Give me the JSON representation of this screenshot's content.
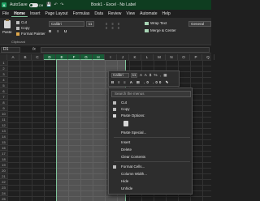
{
  "titlebar": {
    "autosave": "AutoSave",
    "autosave_state": "Off",
    "title": "Book1 - Excel",
    "sensitivity": "No Label"
  },
  "menu_tabs": [
    "File",
    "Home",
    "Insert",
    "Page Layout",
    "Formulas",
    "Data",
    "Review",
    "View",
    "Automate",
    "Help"
  ],
  "active_tab": "Home",
  "ribbon": {
    "paste_label": "Paste",
    "cut_label": "Cut",
    "copy_label": "Copy",
    "format_painter_label": "Format Painter",
    "clipboard_label": "Clipboard",
    "font_name": "Calibri",
    "font_size": "11",
    "font_buttons": "B I U",
    "wrap_text_label": "Wrap Text",
    "merge_center_label": "Merge & Center",
    "number_format": "General"
  },
  "formula_bar": {
    "name_box": "D1",
    "fx": "fx"
  },
  "columns": [
    "A",
    "B",
    "C",
    "D",
    "E",
    "F",
    "G",
    "H",
    "I",
    "J",
    "K",
    "L",
    "M",
    "N",
    "O",
    "P",
    "Q"
  ],
  "selected_columns": [
    "D",
    "E",
    "F",
    "G",
    "H"
  ],
  "rows": [
    "1",
    "2",
    "3",
    "4",
    "5",
    "6",
    "7",
    "8",
    "9",
    "10",
    "11",
    "12",
    "13",
    "14",
    "15",
    "16",
    "17",
    "18",
    "19",
    "20",
    "21",
    "22",
    "23",
    "24",
    "25"
  ],
  "mini_toolbar": {
    "font_name": "Calibri",
    "font_size": "11",
    "row1_symbols": "A A $ % , ▦",
    "row2_symbols": "B I ≡ A ⊞ .0 .00 ✎"
  },
  "context_menu": {
    "search_placeholder": "Search the menus",
    "cut": "Cut",
    "copy": "Copy",
    "paste_options": "Paste Options:",
    "paste_special": "Paste Special...",
    "insert": "Insert",
    "delete": "Delete",
    "clear_contents": "Clear Contents",
    "format_cells": "Format Cells...",
    "column_width": "Column Width...",
    "hide": "Hide",
    "unhide": "Unhide"
  },
  "colors": {
    "accent": "#7fc49a",
    "highlight_box": "#c43dc8"
  }
}
